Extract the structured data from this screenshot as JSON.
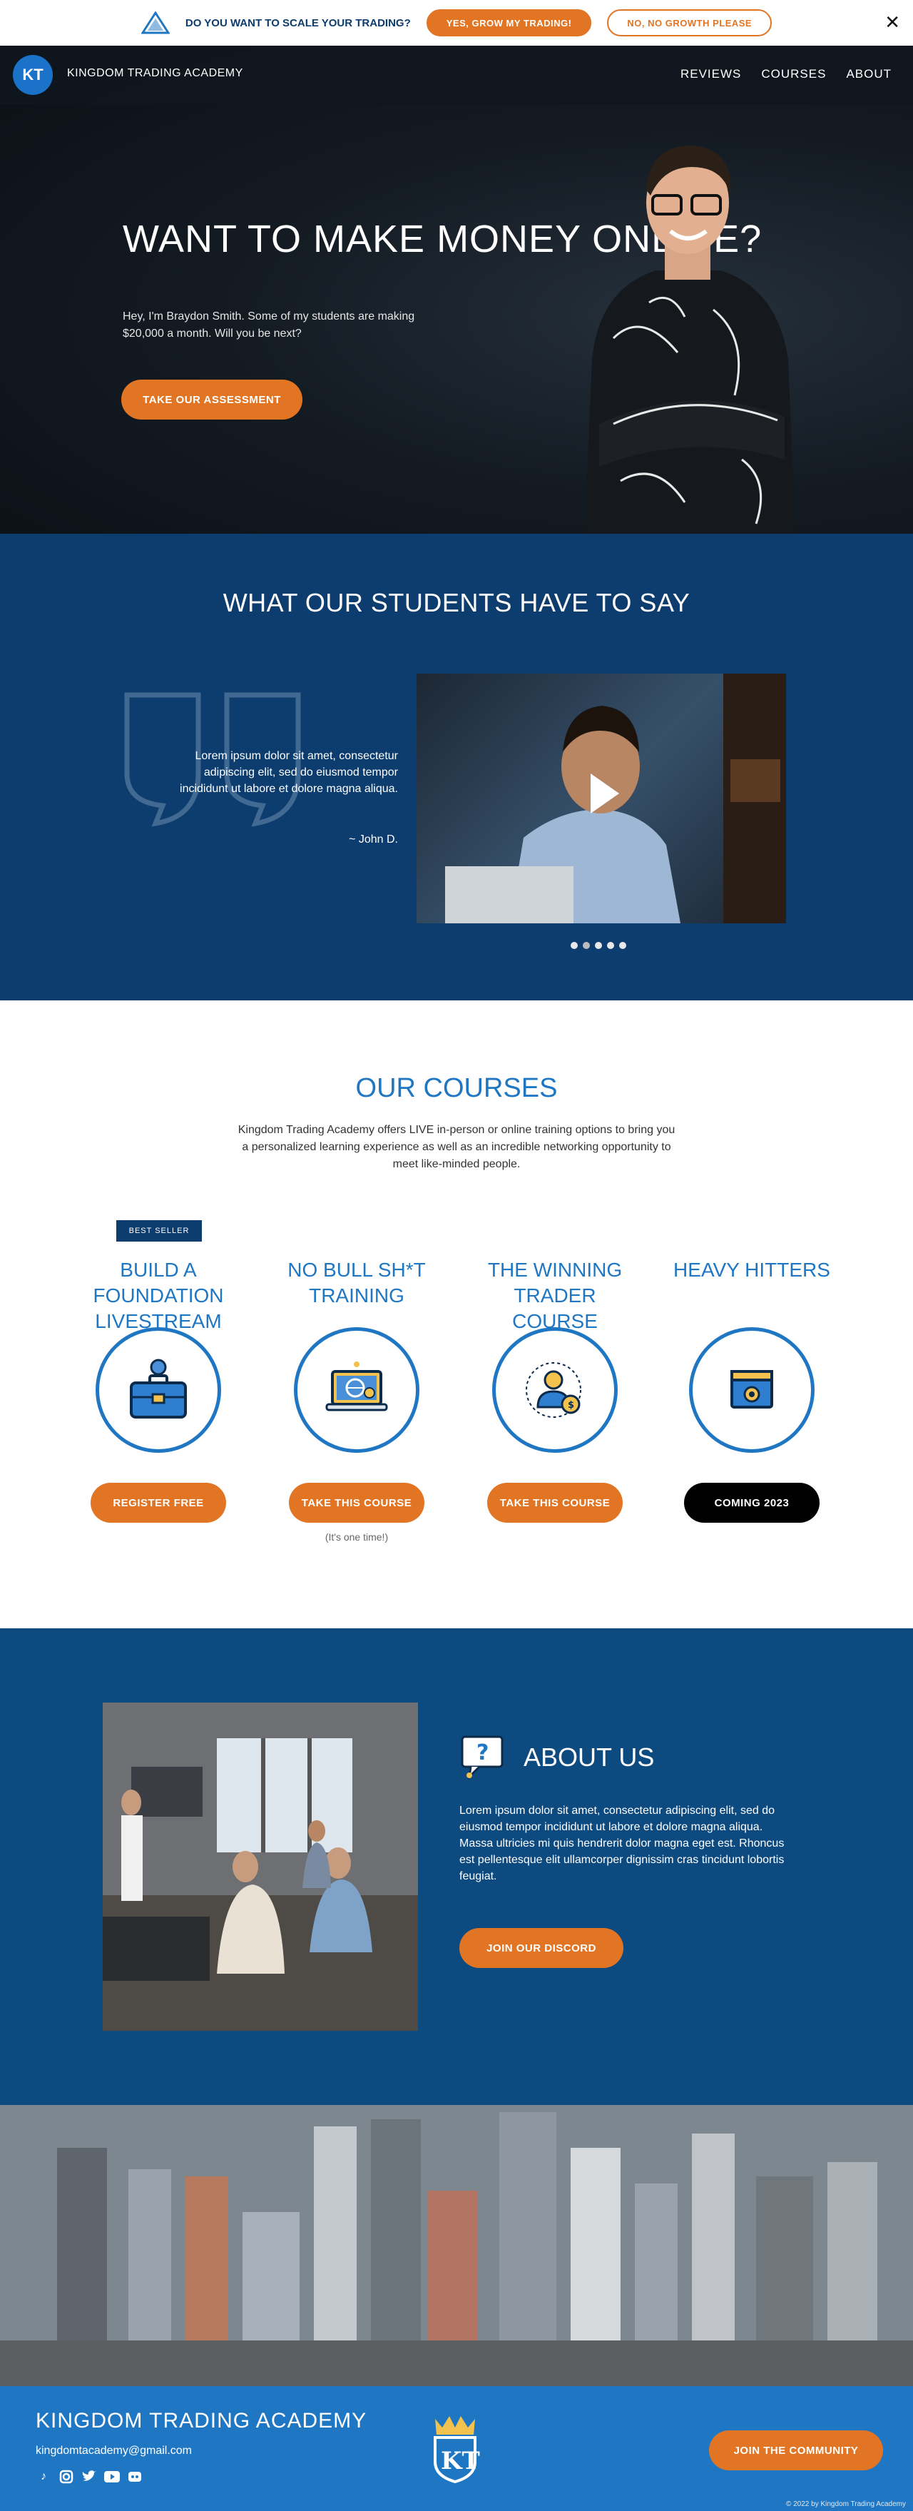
{
  "announcement": {
    "question": "DO YOU WANT TO SCALE YOUR TRADING?",
    "yes_label": "YES, GROW MY TRADING!",
    "no_label": "NO, NO GROWTH PLEASE",
    "close_glyph": "✕"
  },
  "nav": {
    "logo_mark": "KT",
    "brand": "KINGDOM TRADING ACADEMY",
    "links": [
      "REVIEWS",
      "COURSES",
      "ABOUT"
    ]
  },
  "hero": {
    "title": "WANT TO MAKE MONEY ONLINE?",
    "subtitle": "Hey, I'm Braydon Smith. Some of my students are making $20,000 a month. Will you be next?",
    "cta": "TAKE OUR ASSESSMENT"
  },
  "testimonials": {
    "title": "WHAT OUR STUDENTS HAVE TO SAY",
    "quote": "Lorem ipsum dolor sit amet, consectetur adipiscing elit, sed do eiusmod tempor incididunt ut labore et dolore magna aliqua.",
    "author": "~ John D."
  },
  "courses": {
    "title": "OUR COURSES",
    "intro": "Kingdom Trading Academy offers LIVE in-person or online training options to bring you a personalized learning experience as well as an incredible networking opportunity to meet like-minded people.",
    "badge": "BEST SELLER",
    "items": [
      {
        "title": "BUILD A FOUNDATION LIVESTREAM",
        "button": "REGISTER FREE",
        "icon": "briefcase-icon"
      },
      {
        "title": "NO BULL SH*T TRAINING",
        "button": "TAKE THIS COURSE",
        "note": "(It's one time!)",
        "icon": "laptop-globe-icon"
      },
      {
        "title": "THE WINNING TRADER COURSE",
        "button": "TAKE THIS COURSE",
        "icon": "trader-icon"
      },
      {
        "title": "HEAVY HITTERS",
        "button": "COMING 2023",
        "icon": "gear-window-icon"
      }
    ]
  },
  "about": {
    "title": "ABOUT US",
    "body": "Lorem ipsum dolor sit amet, consectetur adipiscing elit, sed do eiusmod tempor incididunt ut labore et dolore magna aliqua. Massa ultricies mi quis hendrerit dolor magna eget est. Rhoncus est pellentesque elit ullamcorper dignissim cras tincidunt lobortis feugiat.",
    "cta": "JOIN OUR DISCORD"
  },
  "footer": {
    "brand": "KINGDOM TRADING ACADEMY",
    "email": "kingdomtacademy@gmail.com",
    "cta": "JOIN THE COMMUNITY",
    "copyright": "© 2022 by Kingdom Trading Academy",
    "socials": [
      "tiktok-icon",
      "instagram-icon",
      "twitter-icon",
      "youtube-icon",
      "discord-icon"
    ]
  },
  "colors": {
    "accent": "#e27524",
    "navy": "#0c3d6e",
    "blue": "#1f77c4"
  }
}
